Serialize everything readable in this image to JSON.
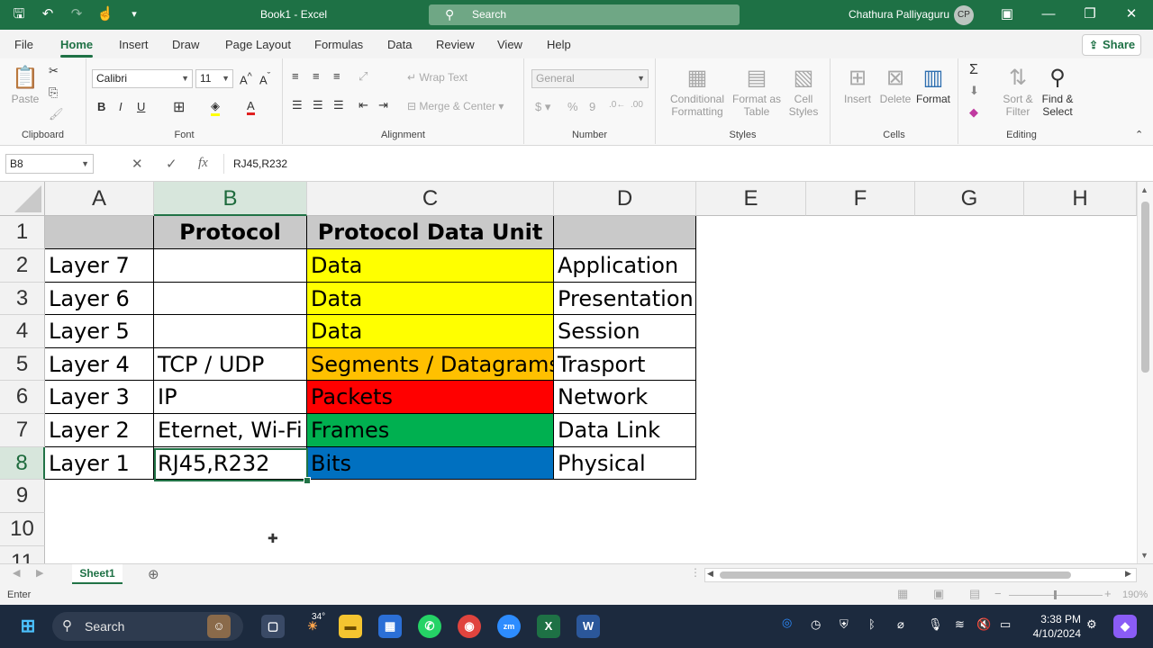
{
  "window": {
    "title": "Book1  -  Excel",
    "search_placeholder": "Search",
    "user_name": "Chathura Palliyaguru",
    "user_initials": "CP"
  },
  "menu": {
    "tabs": [
      "File",
      "Home",
      "Insert",
      "Draw",
      "Page Layout",
      "Formulas",
      "Data",
      "Review",
      "View",
      "Help"
    ],
    "active_tab": "Home",
    "share_label": "Share"
  },
  "ribbon": {
    "clipboard": {
      "label": "Clipboard",
      "paste": "Paste"
    },
    "font": {
      "label": "Font",
      "name": "Calibri",
      "size": "11"
    },
    "alignment": {
      "label": "Alignment",
      "wrap_text": "Wrap Text",
      "merge_center": "Merge & Center"
    },
    "number": {
      "label": "Number",
      "format": "General"
    },
    "styles": {
      "label": "Styles",
      "conditional_1": "Conditional",
      "conditional_2": "Formatting",
      "format_table_1": "Format as",
      "format_table_2": "Table",
      "cell_styles_1": "Cell",
      "cell_styles_2": "Styles"
    },
    "cells": {
      "label": "Cells",
      "insert": "Insert",
      "delete": "Delete",
      "format": "Format"
    },
    "editing": {
      "label": "Editing",
      "sort_1": "Sort &",
      "sort_2": "Filter",
      "find_1": "Find &",
      "find_2": "Select"
    }
  },
  "formula_bar": {
    "name_box": "B8",
    "formula": "RJ45,R232"
  },
  "grid": {
    "columns": [
      "A",
      "B",
      "C",
      "D",
      "E",
      "F",
      "G",
      "H"
    ],
    "rows": [
      "1",
      "2",
      "3",
      "4",
      "5",
      "6",
      "7",
      "8",
      "9",
      "10",
      "11"
    ],
    "header_row": {
      "A": "",
      "B": "Protocol",
      "C": "Protocol Data Unit",
      "D": ""
    },
    "data": [
      {
        "A": "Layer 7",
        "B": "",
        "C": "Data",
        "D": "Application"
      },
      {
        "A": "Layer 6",
        "B": "",
        "C": "Data",
        "D": "Presentation"
      },
      {
        "A": "Layer 5",
        "B": "",
        "C": "Data",
        "D": "Session"
      },
      {
        "A": "Layer 4",
        "B": "TCP / UDP",
        "C": "Segments / Datagrams",
        "D": "Trasport"
      },
      {
        "A": "Layer 3",
        "B": "IP",
        "C": "Packets",
        "D": "Network"
      },
      {
        "A": "Layer 2",
        "B": "Eternet, Wi-Fi",
        "C": "Frames",
        "D": "Data Link"
      },
      {
        "A": "Layer 1",
        "B": "RJ45,R232",
        "C": "Bits",
        "D": "Physical"
      }
    ],
    "pdu_colors": [
      "#ffff00",
      "#ffff00",
      "#ffff00",
      "#ffc000",
      "#ff0000",
      "#00b050",
      "#0070c0"
    ],
    "header_fill": "#c9c9c9",
    "active_cell": "B8"
  },
  "sheets": {
    "tabs": [
      "Sheet1"
    ],
    "active": "Sheet1"
  },
  "status": {
    "mode": "Enter",
    "zoom": "190%"
  },
  "taskbar": {
    "search_label": "Search",
    "weather": "34°",
    "time": "3:38 PM",
    "date": "4/10/2024"
  },
  "colors": {
    "excel_green": "#1e7145",
    "accent": "#217346"
  }
}
